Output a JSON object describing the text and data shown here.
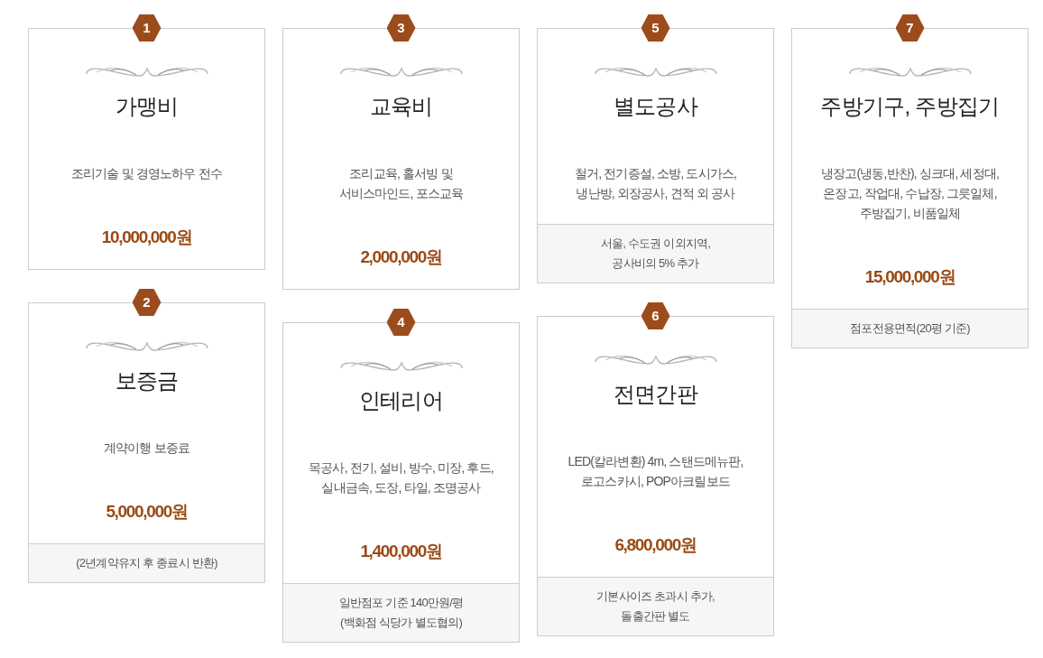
{
  "columns": [
    {
      "cards": [
        {
          "number": "1",
          "title": "가맹비",
          "description": [
            "조리기술 및 경영노하우 전수"
          ],
          "price": "10,000,000원"
        },
        {
          "number": "2",
          "title": "보증금",
          "description": [
            "계약이행 보증료"
          ],
          "price": "5,000,000원",
          "note": [
            "(2년계약유지 후 종료시 반환)"
          ]
        }
      ]
    },
    {
      "cards": [
        {
          "number": "3",
          "title": "교육비",
          "description": [
            "조리교육, 홀서빙 및",
            "서비스마인드, 포스교육"
          ],
          "price": "2,000,000원"
        },
        {
          "number": "4",
          "title": "인테리어",
          "description": [
            "목공사, 전기, 설비, 방수, 미장, 후드,",
            "실내금속, 도장, 타일, 조명공사"
          ],
          "price": "1,400,000원",
          "note": [
            "일반점포 기준 140만원/평",
            "(백화점 식당가 별도협의)"
          ]
        }
      ]
    },
    {
      "cards": [
        {
          "number": "5",
          "title": "별도공사",
          "description": [
            "철거, 전기증설, 소방, 도시가스,",
            "냉난방, 외장공사, 견적 외 공사"
          ],
          "note": [
            "서울, 수도권 이외지역,",
            "공사비의 5% 추가"
          ]
        },
        {
          "number": "6",
          "title": "전면간판",
          "description": [
            "LED(칼라변환) 4m, 스탠드메뉴판,",
            "로고스카시, POP아크릴보드"
          ],
          "price": "6,800,000원",
          "note": [
            "기본사이즈 초과시 추가,",
            "돌출간판 별도"
          ]
        }
      ]
    },
    {
      "cards": [
        {
          "number": "7",
          "title": "주방기구, 주방집기",
          "description": [
            "냉장고(냉동,반찬), 싱크대, 세정대,",
            "온장고, 작업대, 수납장, 그릇일체,",
            "주방집기, 비품일체"
          ],
          "price": "15,000,000원",
          "note": [
            "점포전용면적(20평 기준)"
          ]
        }
      ]
    }
  ]
}
